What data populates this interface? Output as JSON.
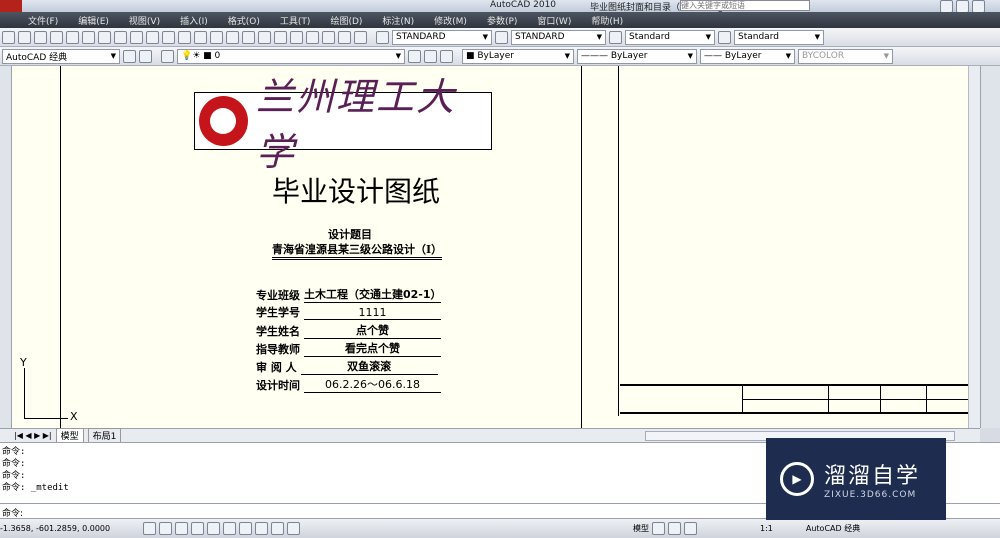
{
  "title_bar": {
    "app": "AutoCAD 2010",
    "file": "毕业图纸封面和目录（模板).dwg",
    "search_placeholder": "键入关键字或短语"
  },
  "menu": [
    "文件(F)",
    "编辑(E)",
    "视图(V)",
    "插入(I)",
    "格式(O)",
    "工具(T)",
    "绘图(D)",
    "标注(N)",
    "修改(M)",
    "参数(P)",
    "窗口(W)",
    "帮助(H)"
  ],
  "styles": {
    "text_style": "STANDARD",
    "dim_style": "STANDARD",
    "table_style": "Standard",
    "multileader_style": "Standard"
  },
  "workspace": "AutoCAD 经典",
  "layer": "0",
  "properties": {
    "color": "ByLayer",
    "linetype": "ByLayer",
    "lineweight": "ByLayer",
    "plotstyle": "BYCOLOR"
  },
  "document": {
    "university": "兰州理工大学",
    "title": "毕业设计图纸",
    "topic_label": "设计题目",
    "topic": "青海省湟源县某三级公路设计（I）",
    "fields": [
      {
        "label": "专业班级",
        "value": "土木工程（交通土建02-1）"
      },
      {
        "label": "学生学号",
        "value": "1111"
      },
      {
        "label": "学生姓名",
        "value": "点个赞"
      },
      {
        "label": "指导教师",
        "value": "看完点个赞"
      },
      {
        "label": "审 阅 人",
        "value": "双鱼滚滚"
      },
      {
        "label": "设计时间",
        "value": "06.2.26～06.6.18"
      }
    ]
  },
  "ucs": {
    "x": "X",
    "y": "Y"
  },
  "tabs": [
    "模型",
    "布局1"
  ],
  "command_history": [
    "命令:",
    "命令:",
    "命令:",
    "命令: _mtedit"
  ],
  "command_prompt": "命令:",
  "coordinates": "-1.3658,  -601.2859, 0.0000",
  "status": {
    "model": "模型",
    "scale": "1:1",
    "workspace": "AutoCAD 经典"
  },
  "watermark": {
    "name": "溜溜自学",
    "url": "ZIXUE.3D66.COM"
  }
}
